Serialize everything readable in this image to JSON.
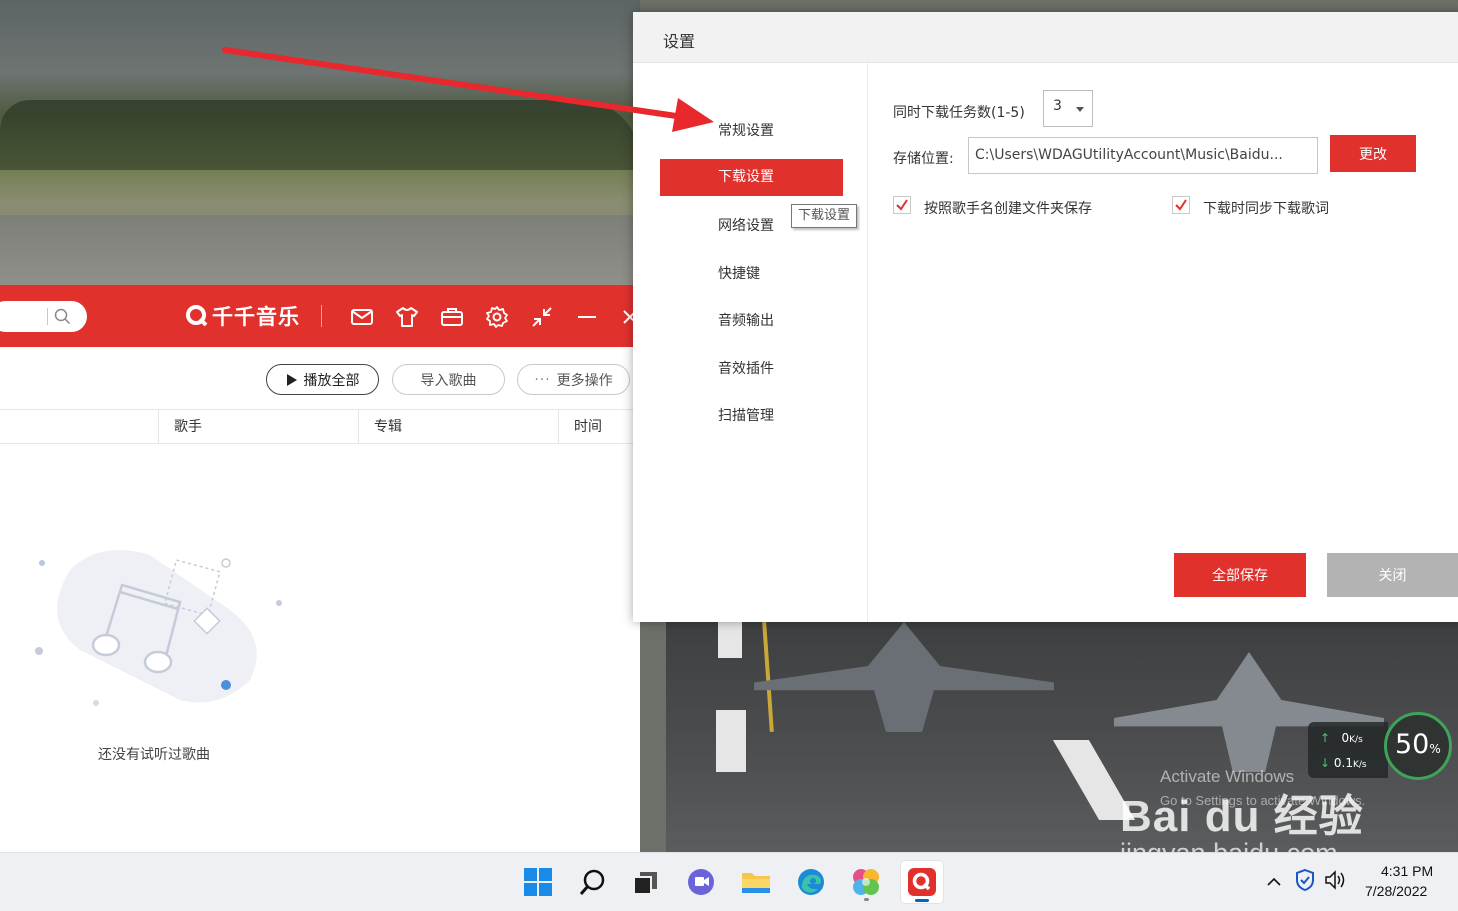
{
  "player": {
    "brand": "千千音乐",
    "toolbar": {
      "play_all": "播放全部",
      "import_songs": "导入歌曲",
      "more_actions": "更多操作"
    },
    "columns": [
      "歌手",
      "专辑",
      "时间"
    ],
    "empty_text": "还没有试听过歌曲"
  },
  "dialog": {
    "title": "设置",
    "nav": [
      "常规设置",
      "下载设置",
      "网络设置",
      "快捷键",
      "音频输出",
      "音效插件",
      "扫描管理"
    ],
    "active_nav": "下载设置",
    "tooltip": "下载设置",
    "concurrent_label": "同时下载任务数(1-5)",
    "concurrent_value": "3",
    "storage_label": "存储位置:",
    "storage_path": "C:\\Users\\WDAGUtilityAccount\\Music\\Baidu...",
    "change_button": "更改",
    "option_folder_by_artist": "按照歌手名创建文件夹保存",
    "option_download_lyrics": "下载时同步下载歌词",
    "save_all_button": "全部保存",
    "close_button": "关闭"
  },
  "speed_widget": {
    "upload": "0",
    "upload_unit": "K/s",
    "download": "0.1",
    "download_unit": "K/s",
    "percent": "50",
    "percent_sign": "%"
  },
  "watermark": {
    "activate_title": "Activate Windows",
    "activate_sub": "Go to Settings to activate Windows.",
    "baidu_logo": "Bai du 经验",
    "baidu_url": "jingyan.baidu.com"
  },
  "taskbar": {
    "time": "4:31 PM",
    "date": "7/28/2022",
    "apps": [
      "start-icon",
      "search-icon",
      "task-view-icon",
      "chat-icon",
      "file-explorer-icon",
      "edge-icon",
      "photos-icon",
      "qianqian-music-icon"
    ]
  },
  "colors": {
    "brand_red": "#e0312d",
    "dialog_gray_button": "#b3b3b3",
    "arrow_red": "#e8282d"
  }
}
